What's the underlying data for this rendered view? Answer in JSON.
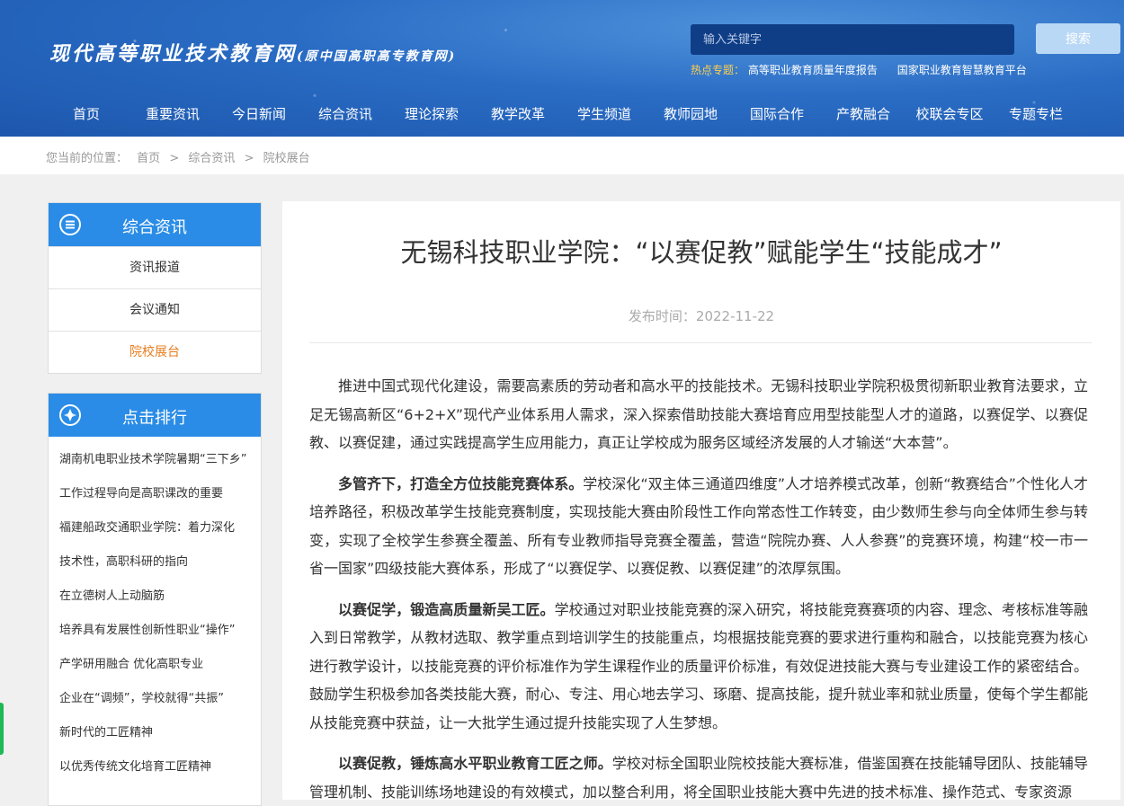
{
  "header": {
    "logo_main": "现代高等职业技术教育网",
    "logo_sub": "(原中国高职高专教育网)",
    "search_placeholder": "输入关键字",
    "search_button": "搜索",
    "hot_label": "热点专题：",
    "hot_links": [
      "高等职业教育质量年度报告",
      "国家职业教育智慧教育平台"
    ]
  },
  "nav": [
    "首页",
    "重要资讯",
    "今日新闻",
    "综合资讯",
    "理论探索",
    "教学改革",
    "学生频道",
    "教师园地",
    "国际合作",
    "产教融合",
    "校联会专区",
    "专题专栏"
  ],
  "breadcrumb": {
    "prefix": "您当前的位置：",
    "items": [
      "首页",
      ">",
      "综合资讯",
      ">",
      "院校展台"
    ]
  },
  "sidebar": {
    "section_title": "综合资讯",
    "menu": [
      "资讯报道",
      "会议通知",
      "院校展台"
    ],
    "rank_title": "点击排行",
    "rank": [
      "湖南机电职业技术学院暑期“三下乡”",
      "工作过程导向是高职课改的重要",
      "福建船政交通职业学院：着力深化",
      "技术性，高职科研的指向",
      "在立德树人上动脑筋",
      "培养具有发展性创新性职业“操作”",
      "产学研用融合 优化高职专业",
      "企业在“调频”，学校就得“共振”",
      "新时代的工匠精神",
      "以优秀传统文化培育工匠精神"
    ]
  },
  "article": {
    "title": "无锡科技职业学院：“以赛促教”赋能学生“技能成才”",
    "date": "发布时间：2022-11-22",
    "p1": "推进中国式现代化建设，需要高素质的劳动者和高水平的技能技术。无锡科技职业学院积极贯彻新职业教育法要求，立足无锡高新区“6+2+X”现代产业体系用人需求，深入探索借助技能大赛培育应用型技能型人才的道路，以赛促学、以赛促教、以赛促建，通过实践提高学生应用能力，真正让学校成为服务区域经济发展的人才输送“大本营”。",
    "p2_lead": "多管齐下，打造全方位技能竞赛体系。",
    "p2": "学校深化“双主体三通道四维度”人才培养模式改革，创新“教赛结合”个性化人才培养路径，积极改革学生技能竞赛制度，实现技能大赛由阶段性工作向常态性工作转变，由少数师生参与向全体师生参与转变，实现了全校学生参赛全覆盖、所有专业教师指导竞赛全覆盖，营造“院院办赛、人人参赛”的竞赛环境，构建“校一市一省一国家”四级技能大赛体系，形成了“以赛促学、以赛促教、以赛促建”的浓厚氛围。",
    "p3_lead": "以赛促学，锻造高质量新吴工匠。",
    "p3": "学校通过对职业技能竞赛的深入研究，将技能竞赛赛项的内容、理念、考核标准等融入到日常教学，从教材选取、教学重点到培训学生的技能重点，均根据技能竞赛的要求进行重构和融合，以技能竞赛为核心进行教学设计，以技能竞赛的评价标准作为学生课程作业的质量评价标准，有效促进技能大赛与专业建设工作的紧密结合。鼓励学生积极参加各类技能大赛，耐心、专注、用心地去学习、琢磨、提高技能，提升就业率和就业质量，使每个学生都能从技能竞赛中获益，让一大批学生通过提升技能实现了人生梦想。",
    "p4_lead": "以赛促教，锤炼高水平职业教育工匠之师。",
    "p4": "学校对标全国职业院校技能大赛标准，借鉴国赛在技能辅导团队、技能辅导管理机制、技能训练场地建设的有效模式，加以整合利用，将全国职业技能大赛中先进的技术标准、操作范式、专家资源"
  }
}
